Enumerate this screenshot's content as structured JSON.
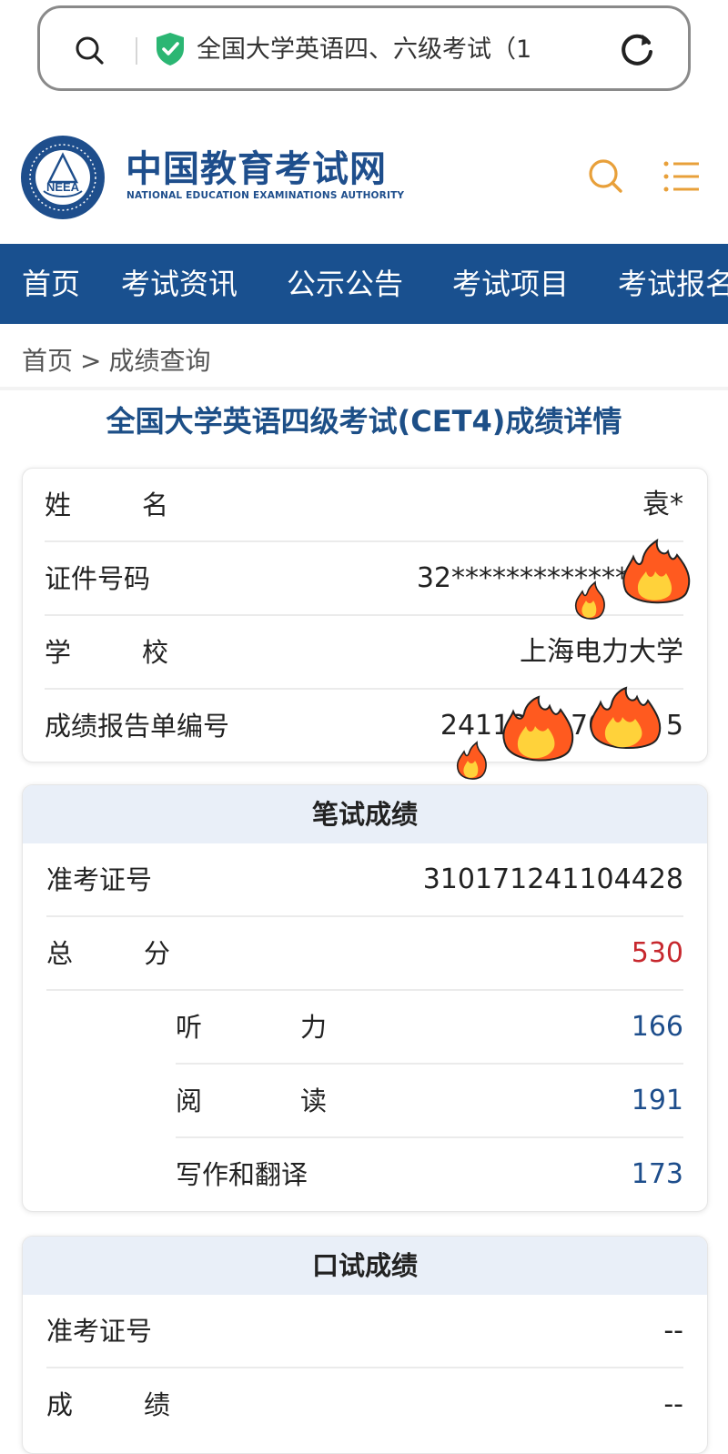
{
  "browser": {
    "url_text": "全国大学英语四、六级考试（1"
  },
  "site": {
    "logo_badge": "NEEA",
    "name_cn": "中国教育考试网",
    "name_en": "NATIONAL EDUCATION EXAMINATIONS AUTHORITY"
  },
  "nav": {
    "items": [
      "首页",
      "考试资讯",
      "公示公告",
      "考试项目",
      "考试报名"
    ]
  },
  "breadcrumb": {
    "home": "首页",
    "separator": ">",
    "current": "成绩查询"
  },
  "page_title": "全国大学英语四级考试(CET4)成绩详情",
  "personal": {
    "name_label": [
      "姓",
      "名"
    ],
    "name_value": "袁*",
    "id_label": "证件号码",
    "id_value": "32*************",
    "school_label": [
      "学",
      "校"
    ],
    "school_value": "上海电力大学",
    "report_label": "成绩报告单编号",
    "report_value": "24113     70       5"
  },
  "written": {
    "title": "笔试成绩",
    "ticket_label": "准考证号",
    "ticket_value": "310171241104428",
    "total_label": [
      "总",
      "分"
    ],
    "total_value": "530",
    "listening_label": [
      "听",
      "力"
    ],
    "listening_value": "166",
    "reading_label": [
      "阅",
      "读"
    ],
    "reading_value": "191",
    "writing_label": "写作和翻译",
    "writing_value": "173"
  },
  "oral": {
    "title": "口试成绩",
    "ticket_label": "准考证号",
    "ticket_value": "--",
    "score_label": [
      "成",
      "绩"
    ],
    "score_value": "--"
  },
  "colors": {
    "brand_blue": "#19508f",
    "title_blue": "#1d4f87",
    "score_red": "#c7282e",
    "card_head_bg": "#e9eff8",
    "shield_green": "#2bb673"
  },
  "icons": [
    "search-icon",
    "shield-check-icon",
    "reload-icon",
    "neea-emblem-icon",
    "menu-icon",
    "flame-sticker-icon"
  ]
}
